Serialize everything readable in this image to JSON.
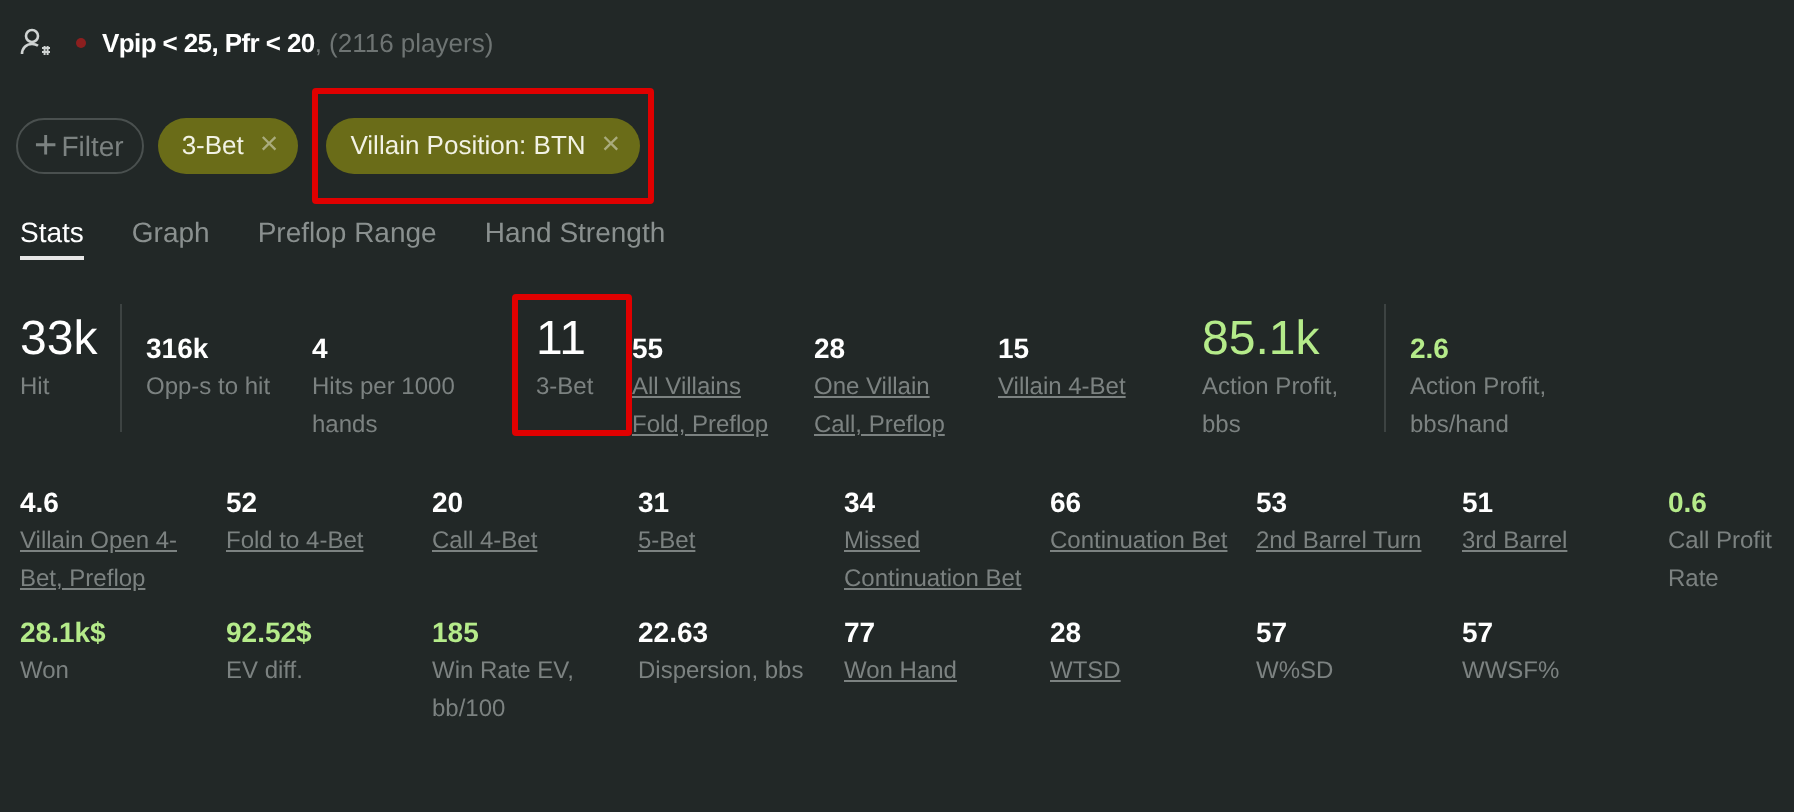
{
  "header": {
    "title": "Vpip < 25, Pfr < 20",
    "count": ", (2116 players)"
  },
  "filters": {
    "add_icon": "+",
    "add_label": "Filter",
    "chips": [
      {
        "label": "3-Bet",
        "remove": "×",
        "highlighted": false
      },
      {
        "label": "Villain Position: BTN",
        "remove": "×",
        "highlighted": true
      }
    ]
  },
  "tabs": [
    {
      "label": "Stats",
      "selected": true
    },
    {
      "label": "Graph",
      "selected": false
    },
    {
      "label": "Preflop Range",
      "selected": false
    },
    {
      "label": "Hand Strength",
      "selected": false
    }
  ],
  "stat_rows": [
    [
      {
        "value": "33k",
        "label": "Hit",
        "kind": "large",
        "positive": false,
        "link": false,
        "highlighted": false,
        "divider_after": true
      },
      {
        "value": "316k",
        "label": "Opp-s to hit",
        "kind": "small",
        "positive": false,
        "link": false,
        "highlighted": false,
        "divider_after": false
      },
      {
        "value": "4",
        "label": "Hits per 1000 hands",
        "kind": "small",
        "positive": false,
        "link": false,
        "highlighted": false,
        "divider_after": false
      },
      {
        "value": "11",
        "label": "3-Bet",
        "kind": "large",
        "positive": false,
        "link": false,
        "highlighted": true,
        "divider_after": false
      },
      {
        "value": "55",
        "label": "All Villains Fold, Preflop",
        "kind": "small",
        "positive": false,
        "link": true,
        "highlighted": false,
        "divider_after": false
      },
      {
        "value": "28",
        "label": "One Villain Call, Preflop",
        "kind": "small",
        "positive": false,
        "link": true,
        "highlighted": false,
        "divider_after": false
      },
      {
        "value": "15",
        "label": "Villain 4-Bet",
        "kind": "small",
        "positive": false,
        "link": true,
        "highlighted": false,
        "divider_after": false
      },
      {
        "value": "85.1k",
        "label": "Action Profit, bbs",
        "kind": "large",
        "positive": true,
        "link": false,
        "highlighted": false,
        "divider_after": true
      },
      {
        "value": "2.6",
        "label": "Action Profit, bbs/hand",
        "kind": "small",
        "positive": true,
        "link": false,
        "highlighted": false,
        "divider_after": false
      }
    ],
    [
      {
        "value": "4.6",
        "label": "Villain Open 4-Bet, Preflop",
        "kind": "small",
        "positive": false,
        "link": true,
        "highlighted": false,
        "divider_after": false
      },
      {
        "value": "52",
        "label": "Fold to 4-Bet",
        "kind": "small",
        "positive": false,
        "link": true,
        "highlighted": false,
        "divider_after": false
      },
      {
        "value": "20",
        "label": "Call 4-Bet",
        "kind": "small",
        "positive": false,
        "link": true,
        "highlighted": false,
        "divider_after": false
      },
      {
        "value": "31",
        "label": "5-Bet",
        "kind": "small",
        "positive": false,
        "link": true,
        "highlighted": false,
        "divider_after": false
      },
      {
        "value": "34",
        "label": "Missed Continuation Bet",
        "kind": "small",
        "positive": false,
        "link": true,
        "highlighted": false,
        "divider_after": false
      },
      {
        "value": "66",
        "label": "Continuation Bet",
        "kind": "small",
        "positive": false,
        "link": true,
        "highlighted": false,
        "divider_after": false
      },
      {
        "value": "53",
        "label": "2nd Barrel Turn",
        "kind": "small",
        "positive": false,
        "link": true,
        "highlighted": false,
        "divider_after": false
      },
      {
        "value": "51",
        "label": "3rd Barrel",
        "kind": "small",
        "positive": false,
        "link": true,
        "highlighted": false,
        "divider_after": false
      },
      {
        "value": "0.6",
        "label": "Call Profit Rate",
        "kind": "small",
        "positive": true,
        "link": false,
        "highlighted": false,
        "divider_after": false
      }
    ],
    [
      {
        "value": "28.1k$",
        "label": "Won",
        "kind": "small",
        "positive": true,
        "link": false,
        "highlighted": false,
        "divider_after": false
      },
      {
        "value": "92.52$",
        "label": "EV diff.",
        "kind": "small",
        "positive": true,
        "link": false,
        "highlighted": false,
        "divider_after": false
      },
      {
        "value": "185",
        "label": "Win Rate EV, bb/100",
        "kind": "small",
        "positive": true,
        "link": false,
        "highlighted": false,
        "divider_after": false
      },
      {
        "value": "22.63",
        "label": "Dispersion, bbs",
        "kind": "small",
        "positive": false,
        "link": false,
        "highlighted": false,
        "divider_after": false
      },
      {
        "value": "77",
        "label": "Won Hand",
        "kind": "small",
        "positive": false,
        "link": true,
        "highlighted": false,
        "divider_after": false
      },
      {
        "value": "28",
        "label": "WTSD",
        "kind": "small",
        "positive": false,
        "link": true,
        "highlighted": false,
        "divider_after": false
      },
      {
        "value": "57",
        "label": "W%SD",
        "kind": "small",
        "positive": false,
        "link": false,
        "highlighted": false,
        "divider_after": false
      },
      {
        "value": "57",
        "label": "WWSF%",
        "kind": "small",
        "positive": false,
        "link": false,
        "highlighted": false,
        "divider_after": false
      }
    ]
  ]
}
